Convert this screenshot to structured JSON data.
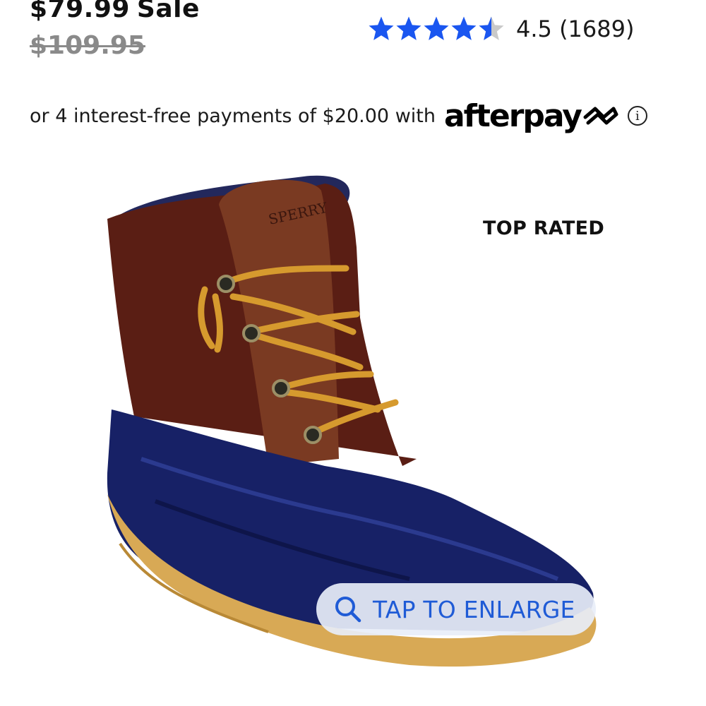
{
  "price": {
    "sale_amount": "$79.99",
    "sale_label": "Sale",
    "original": "$109.95"
  },
  "rating": {
    "value": 4.5,
    "text": "4.5 (1689)",
    "star_color": "#1a56f0",
    "empty_color": "#c9c9c9"
  },
  "payment": {
    "text": "or 4 interest-free payments of $20.00 with",
    "provider": "afterpay",
    "info_glyph": "i"
  },
  "badge": {
    "label": "TOP RATED"
  },
  "image": {
    "icon": "boot-product-image"
  },
  "enlarge": {
    "label": "TAP TO ENLARGE",
    "icon": "search-icon",
    "color": "#1f5bd6"
  }
}
